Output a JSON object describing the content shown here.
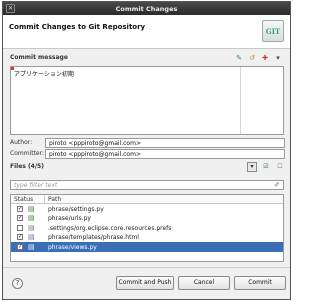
{
  "window": {
    "title": "Commit Changes"
  },
  "header": {
    "title": "Commit Changes to Git Repository",
    "logo_text": "GIT"
  },
  "commit_message": {
    "section_label": "Commit message",
    "text": "アプリケーション初期",
    "toolbar_icons": [
      "sign-off-icon",
      "amend-icon",
      "add-ref-icon",
      "menu-arrow-icon"
    ]
  },
  "author": {
    "label": "Author:",
    "value": "piroto <pppiroto@gmail.com>"
  },
  "committer": {
    "label": "Committer:",
    "value": "piroto <pppiroto@gmail.com>"
  },
  "files": {
    "section_label": "Files (4/5)",
    "filter_placeholder": "type filter text",
    "columns": {
      "status": "Status",
      "path": "Path"
    },
    "rows": [
      {
        "checked": true,
        "path": "phrase/settings.py",
        "selected": false
      },
      {
        "checked": true,
        "path": "phrase/urls.py",
        "selected": false
      },
      {
        "checked": false,
        "path": ".settings/org.eclipse.core.resources.prefs",
        "selected": false
      },
      {
        "checked": true,
        "path": "phrase/templates/phrase.html",
        "selected": false
      },
      {
        "checked": true,
        "path": "phrase/views.py",
        "selected": true
      }
    ]
  },
  "buttons": {
    "help": "?",
    "commit_and_push": "Commit and Push",
    "cancel": "Cancel",
    "commit": "Commit"
  },
  "colors": {
    "selection": "#3a6fb8",
    "title_bar": "#2e2e2e"
  }
}
